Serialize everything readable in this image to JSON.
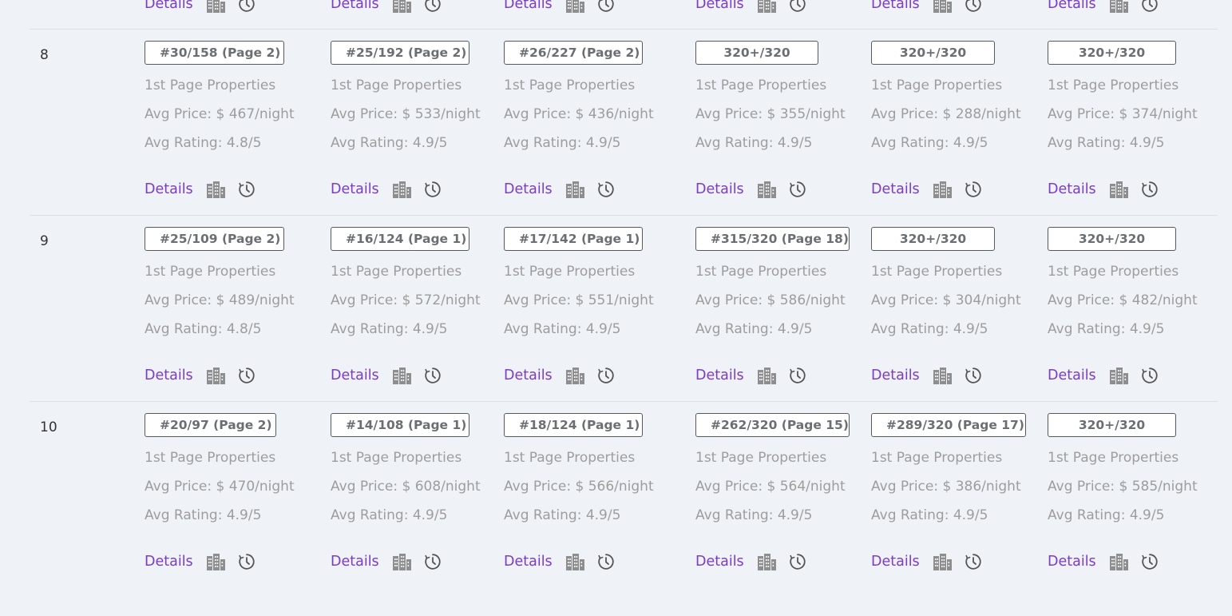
{
  "details_label": "Details",
  "partial_row": {
    "actions_count": 6
  },
  "rows": [
    {
      "rank": "8",
      "cells": [
        {
          "badge": "#30/158 (Page 2)",
          "props": "1st Page Properties",
          "price": "Avg Price: $ 467/night",
          "rating": "Avg Rating: 4.8/5"
        },
        {
          "badge": "#25/192 (Page 2)",
          "props": "1st Page Properties",
          "price": "Avg Price: $ 533/night",
          "rating": "Avg Rating: 4.9/5"
        },
        {
          "badge": "#26/227 (Page 2)",
          "props": "1st Page Properties",
          "price": "Avg Price: $ 436/night",
          "rating": "Avg Rating: 4.9/5"
        },
        {
          "badge": "320+/320",
          "props": "1st Page Properties",
          "price": "Avg Price: $ 355/night",
          "rating": "Avg Rating: 4.9/5"
        },
        {
          "badge": "320+/320",
          "props": "1st Page Properties",
          "price": "Avg Price: $ 288/night",
          "rating": "Avg Rating: 4.9/5"
        },
        {
          "badge": "320+/320",
          "props": "1st Page Properties",
          "price": "Avg Price: $ 374/night",
          "rating": "Avg Rating: 4.9/5"
        }
      ]
    },
    {
      "rank": "9",
      "cells": [
        {
          "badge": "#25/109 (Page 2)",
          "props": "1st Page Properties",
          "price": "Avg Price: $ 489/night",
          "rating": "Avg Rating: 4.8/5"
        },
        {
          "badge": "#16/124 (Page 1)",
          "props": "1st Page Properties",
          "price": "Avg Price: $ 572/night",
          "rating": "Avg Rating: 4.9/5"
        },
        {
          "badge": "#17/142 (Page 1)",
          "props": "1st Page Properties",
          "price": "Avg Price: $ 551/night",
          "rating": "Avg Rating: 4.9/5"
        },
        {
          "badge": "#315/320 (Page 18)",
          "props": "1st Page Properties",
          "price": "Avg Price: $ 586/night",
          "rating": "Avg Rating: 4.9/5"
        },
        {
          "badge": "320+/320",
          "props": "1st Page Properties",
          "price": "Avg Price: $ 304/night",
          "rating": "Avg Rating: 4.9/5"
        },
        {
          "badge": "320+/320",
          "props": "1st Page Properties",
          "price": "Avg Price: $ 482/night",
          "rating": "Avg Rating: 4.9/5"
        }
      ]
    },
    {
      "rank": "10",
      "cells": [
        {
          "badge": "#20/97 (Page 2)",
          "props": "1st Page Properties",
          "price": "Avg Price: $ 470/night",
          "rating": "Avg Rating: 4.9/5"
        },
        {
          "badge": "#14/108 (Page 1)",
          "props": "1st Page Properties",
          "price": "Avg Price: $ 608/night",
          "rating": "Avg Rating: 4.9/5"
        },
        {
          "badge": "#18/124 (Page 1)",
          "props": "1st Page Properties",
          "price": "Avg Price: $ 566/night",
          "rating": "Avg Rating: 4.9/5"
        },
        {
          "badge": "#262/320 (Page 15)",
          "props": "1st Page Properties",
          "price": "Avg Price: $ 564/night",
          "rating": "Avg Rating: 4.9/5"
        },
        {
          "badge": "#289/320 (Page 17)",
          "props": "1st Page Properties",
          "price": "Avg Price: $ 386/night",
          "rating": "Avg Rating: 4.9/5"
        },
        {
          "badge": "320+/320",
          "props": "1st Page Properties",
          "price": "Avg Price: $ 585/night",
          "rating": "Avg Rating: 4.9/5"
        }
      ]
    }
  ],
  "colors": {
    "background": "#eff2f7",
    "details_link": "#7b3cc6",
    "icon": "#8e8e8e",
    "badge_border": "#555a60"
  },
  "icons": [
    "building-icon",
    "clock-history-icon"
  ]
}
